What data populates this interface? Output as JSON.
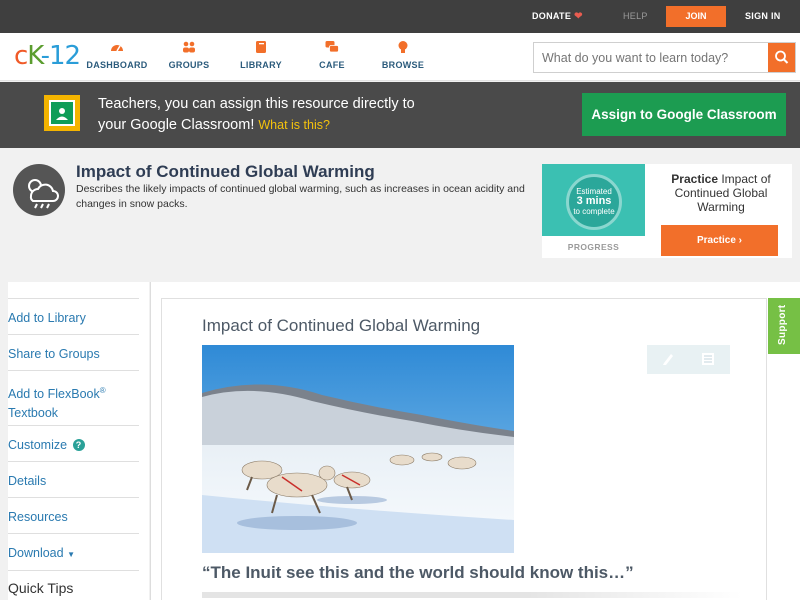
{
  "topbar": {
    "donate": "DONATE",
    "help": "HELP",
    "join": "JOIN",
    "signin": "SIGN IN"
  },
  "nav": {
    "logo": {
      "c": "c",
      "k": "K",
      "n": "-12"
    },
    "items": [
      {
        "label": "DASHBOARD",
        "icon": "dashboard-gauge-icon"
      },
      {
        "label": "GROUPS",
        "icon": "groups-people-icon"
      },
      {
        "label": "LIBRARY",
        "icon": "library-book-icon"
      },
      {
        "label": "CAFE",
        "icon": "cafe-chat-bubbles-icon"
      },
      {
        "label": "BROWSE",
        "icon": "browse-lightbulb-icon"
      }
    ],
    "search_placeholder": "What do you want to learn today?"
  },
  "banner": {
    "text_1": "Teachers, you can assign this resource directly to",
    "text_2": "your Google Classroom!",
    "what": "What is this?",
    "assign_button": "Assign to Google Classroom"
  },
  "header": {
    "title": "Impact of Continued Global Warming",
    "description": "Describes the likely impacts of continued global warming, such as increases in ocean acidity and changes in snow packs."
  },
  "practice": {
    "estimated_1": "Estimated",
    "estimated_2": "3 mins",
    "estimated_3": "to complete",
    "progress_label": "PROGRESS",
    "title_bold": "Practice",
    "title_rest": "Impact of Continued Global Warming",
    "button": "Practice"
  },
  "sidebar": {
    "items": [
      {
        "label": "Add to Library"
      },
      {
        "label": "Share to Groups"
      },
      {
        "label": "Add to FlexBook",
        "sup": "®",
        "line2": "Textbook"
      },
      {
        "label": "Customize"
      },
      {
        "label": "Details"
      },
      {
        "label": "Resources"
      },
      {
        "label": "Download"
      }
    ],
    "quick_tips": "Quick Tips"
  },
  "content": {
    "title": "Impact of Continued Global Warming",
    "quote": "“The Inuit see this and the world should know this…”",
    "support": "Support"
  },
  "colors": {
    "accent_orange": "#f26f2a",
    "google_green": "#1c9c51",
    "link_blue": "#2a7ab0",
    "support_green": "#76c045"
  }
}
